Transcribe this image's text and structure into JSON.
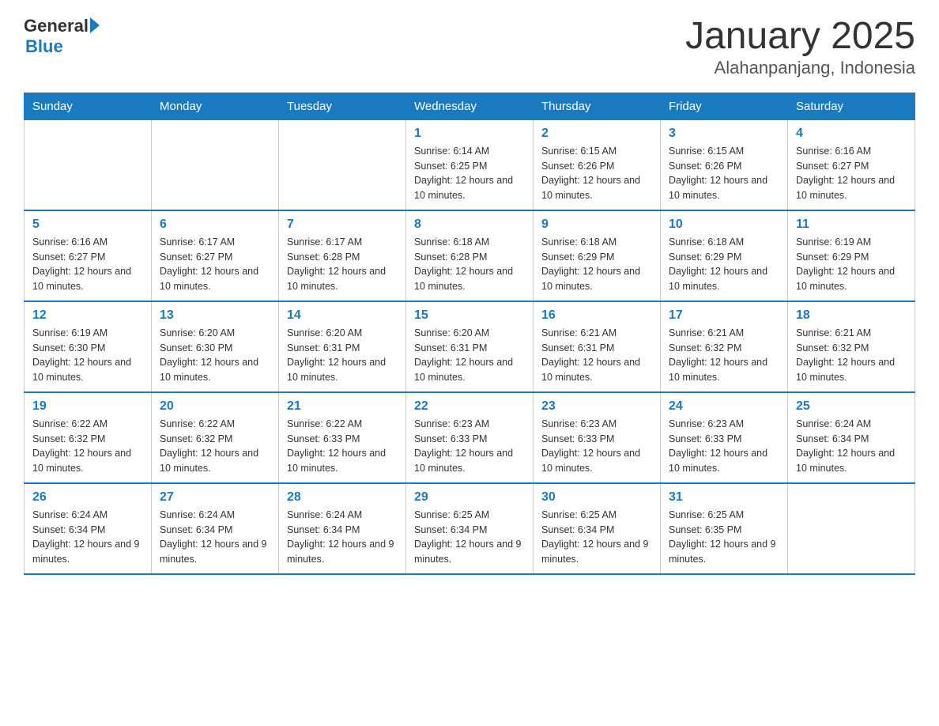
{
  "header": {
    "logo_general": "General",
    "logo_blue": "Blue",
    "title": "January 2025",
    "subtitle": "Alahanpanjang, Indonesia"
  },
  "days_of_week": [
    "Sunday",
    "Monday",
    "Tuesday",
    "Wednesday",
    "Thursday",
    "Friday",
    "Saturday"
  ],
  "weeks": [
    [
      {
        "day": "",
        "info": ""
      },
      {
        "day": "",
        "info": ""
      },
      {
        "day": "",
        "info": ""
      },
      {
        "day": "1",
        "info": "Sunrise: 6:14 AM\nSunset: 6:25 PM\nDaylight: 12 hours and 10 minutes."
      },
      {
        "day": "2",
        "info": "Sunrise: 6:15 AM\nSunset: 6:26 PM\nDaylight: 12 hours and 10 minutes."
      },
      {
        "day": "3",
        "info": "Sunrise: 6:15 AM\nSunset: 6:26 PM\nDaylight: 12 hours and 10 minutes."
      },
      {
        "day": "4",
        "info": "Sunrise: 6:16 AM\nSunset: 6:27 PM\nDaylight: 12 hours and 10 minutes."
      }
    ],
    [
      {
        "day": "5",
        "info": "Sunrise: 6:16 AM\nSunset: 6:27 PM\nDaylight: 12 hours and 10 minutes."
      },
      {
        "day": "6",
        "info": "Sunrise: 6:17 AM\nSunset: 6:27 PM\nDaylight: 12 hours and 10 minutes."
      },
      {
        "day": "7",
        "info": "Sunrise: 6:17 AM\nSunset: 6:28 PM\nDaylight: 12 hours and 10 minutes."
      },
      {
        "day": "8",
        "info": "Sunrise: 6:18 AM\nSunset: 6:28 PM\nDaylight: 12 hours and 10 minutes."
      },
      {
        "day": "9",
        "info": "Sunrise: 6:18 AM\nSunset: 6:29 PM\nDaylight: 12 hours and 10 minutes."
      },
      {
        "day": "10",
        "info": "Sunrise: 6:18 AM\nSunset: 6:29 PM\nDaylight: 12 hours and 10 minutes."
      },
      {
        "day": "11",
        "info": "Sunrise: 6:19 AM\nSunset: 6:29 PM\nDaylight: 12 hours and 10 minutes."
      }
    ],
    [
      {
        "day": "12",
        "info": "Sunrise: 6:19 AM\nSunset: 6:30 PM\nDaylight: 12 hours and 10 minutes."
      },
      {
        "day": "13",
        "info": "Sunrise: 6:20 AM\nSunset: 6:30 PM\nDaylight: 12 hours and 10 minutes."
      },
      {
        "day": "14",
        "info": "Sunrise: 6:20 AM\nSunset: 6:31 PM\nDaylight: 12 hours and 10 minutes."
      },
      {
        "day": "15",
        "info": "Sunrise: 6:20 AM\nSunset: 6:31 PM\nDaylight: 12 hours and 10 minutes."
      },
      {
        "day": "16",
        "info": "Sunrise: 6:21 AM\nSunset: 6:31 PM\nDaylight: 12 hours and 10 minutes."
      },
      {
        "day": "17",
        "info": "Sunrise: 6:21 AM\nSunset: 6:32 PM\nDaylight: 12 hours and 10 minutes."
      },
      {
        "day": "18",
        "info": "Sunrise: 6:21 AM\nSunset: 6:32 PM\nDaylight: 12 hours and 10 minutes."
      }
    ],
    [
      {
        "day": "19",
        "info": "Sunrise: 6:22 AM\nSunset: 6:32 PM\nDaylight: 12 hours and 10 minutes."
      },
      {
        "day": "20",
        "info": "Sunrise: 6:22 AM\nSunset: 6:32 PM\nDaylight: 12 hours and 10 minutes."
      },
      {
        "day": "21",
        "info": "Sunrise: 6:22 AM\nSunset: 6:33 PM\nDaylight: 12 hours and 10 minutes."
      },
      {
        "day": "22",
        "info": "Sunrise: 6:23 AM\nSunset: 6:33 PM\nDaylight: 12 hours and 10 minutes."
      },
      {
        "day": "23",
        "info": "Sunrise: 6:23 AM\nSunset: 6:33 PM\nDaylight: 12 hours and 10 minutes."
      },
      {
        "day": "24",
        "info": "Sunrise: 6:23 AM\nSunset: 6:33 PM\nDaylight: 12 hours and 10 minutes."
      },
      {
        "day": "25",
        "info": "Sunrise: 6:24 AM\nSunset: 6:34 PM\nDaylight: 12 hours and 10 minutes."
      }
    ],
    [
      {
        "day": "26",
        "info": "Sunrise: 6:24 AM\nSunset: 6:34 PM\nDaylight: 12 hours and 9 minutes."
      },
      {
        "day": "27",
        "info": "Sunrise: 6:24 AM\nSunset: 6:34 PM\nDaylight: 12 hours and 9 minutes."
      },
      {
        "day": "28",
        "info": "Sunrise: 6:24 AM\nSunset: 6:34 PM\nDaylight: 12 hours and 9 minutes."
      },
      {
        "day": "29",
        "info": "Sunrise: 6:25 AM\nSunset: 6:34 PM\nDaylight: 12 hours and 9 minutes."
      },
      {
        "day": "30",
        "info": "Sunrise: 6:25 AM\nSunset: 6:34 PM\nDaylight: 12 hours and 9 minutes."
      },
      {
        "day": "31",
        "info": "Sunrise: 6:25 AM\nSunset: 6:35 PM\nDaylight: 12 hours and 9 minutes."
      },
      {
        "day": "",
        "info": ""
      }
    ]
  ]
}
